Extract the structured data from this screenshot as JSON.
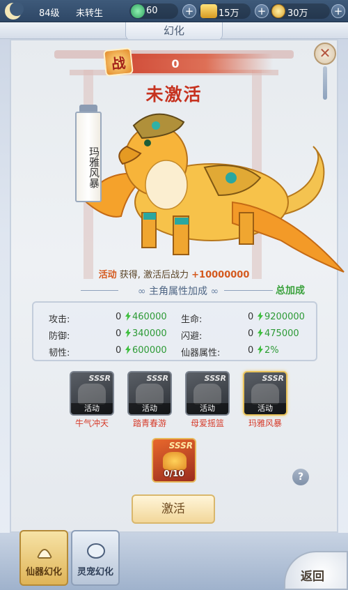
{
  "topbar": {
    "level": "84级",
    "rebirth": "未转生",
    "stamina": "60",
    "gold": "15万",
    "coins": "30万"
  },
  "title": "幻化",
  "power": {
    "icon_char": "战",
    "value": "0"
  },
  "status": "未激活",
  "pet_name": "玛雅风暴",
  "obtain": {
    "source": "活动",
    "text": "获得, 激活后战力",
    "bonus": "+10000000"
  },
  "attributes": {
    "heading": "主角属性加成",
    "total_label": "总加成",
    "rows": [
      {
        "label": "攻击:",
        "value": "0",
        "bonus": "460000"
      },
      {
        "label": "生命:",
        "value": "0",
        "bonus": "9200000"
      },
      {
        "label": "防御:",
        "value": "0",
        "bonus": "340000"
      },
      {
        "label": "闪避:",
        "value": "0",
        "bonus": "475000"
      },
      {
        "label": "韧性:",
        "value": "0",
        "bonus": "600000"
      },
      {
        "label": "仙器属性:",
        "value": "0",
        "bonus": "2%"
      }
    ]
  },
  "cards": [
    {
      "rarity": "SSSR",
      "tag": "活动",
      "name": "牛气冲天"
    },
    {
      "rarity": "SSSR",
      "tag": "活动",
      "name": "踏青春游"
    },
    {
      "rarity": "SSSR",
      "tag": "活动",
      "name": "母爱摇篮"
    },
    {
      "rarity": "SSSR",
      "tag": "活动",
      "name": "玛雅风暴"
    }
  ],
  "item": {
    "rarity": "SSSR",
    "count": "0/10"
  },
  "help": "?",
  "activate": "激活",
  "nav": {
    "tab1": "仙器幻化",
    "tab2": "灵宠幻化",
    "back": "返回"
  },
  "colors": {
    "accent_red": "#c6321f",
    "bonus_green": "#2c9a35",
    "gold": "#e8c25a"
  }
}
